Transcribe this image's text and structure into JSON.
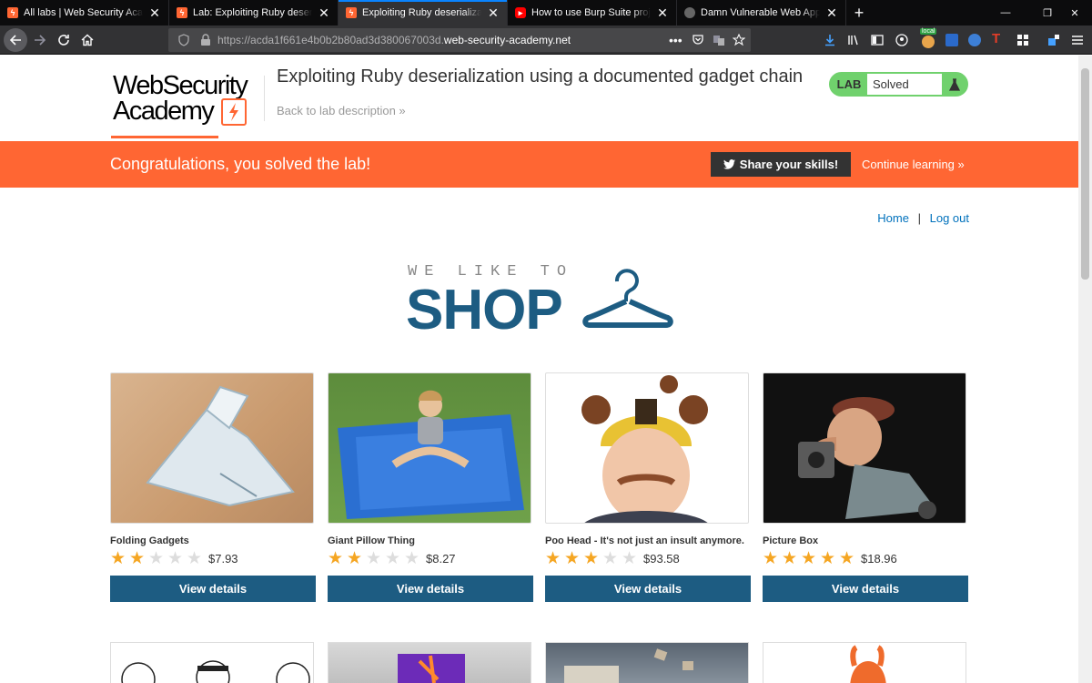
{
  "browser": {
    "tabs": [
      {
        "title": "All labs | Web Security Academy",
        "favicon": "web-security-academy-icon",
        "active": false
      },
      {
        "title": "Lab: Exploiting Ruby deserialization",
        "favicon": "web-security-academy-icon",
        "active": false
      },
      {
        "title": "Exploiting Ruby deserialization",
        "favicon": "web-security-academy-icon",
        "active": true
      },
      {
        "title": "How to use Burp Suite projects",
        "favicon": "youtube-icon",
        "active": false
      },
      {
        "title": "Damn Vulnerable Web App (DVWA)",
        "favicon": "dvwa-icon",
        "active": false
      }
    ],
    "url_prefix": "https://acda1f661e4b0b2b80ad3d380067003d.",
    "url_domain": "web-security-academy.net",
    "extension_badge": "local"
  },
  "header": {
    "logo_line1": "WebSecurity",
    "logo_line2": "Academy",
    "lab_title": "Exploiting Ruby deserialization using a documented gadget chain",
    "back_link": "Back to lab description",
    "lab_label": "LAB",
    "lab_status": "Solved"
  },
  "banner": {
    "message": "Congratulations, you solved the lab!",
    "share_button": "Share your skills!",
    "continue_link": "Continue learning"
  },
  "nav": {
    "home": "Home",
    "separator": "|",
    "logout": "Log out"
  },
  "shop": {
    "tagline": "WE LIKE TO",
    "title": "SHOP"
  },
  "products": [
    {
      "name": "Folding Gadgets",
      "rating": 2,
      "price": "$7.93",
      "button": "View details"
    },
    {
      "name": "Giant Pillow Thing",
      "rating": 2,
      "price": "$8.27",
      "button": "View details"
    },
    {
      "name": "Poo Head - It's not just an insult anymore.",
      "rating": 3,
      "price": "$93.58",
      "button": "View details"
    },
    {
      "name": "Picture Box",
      "rating": 5,
      "price": "$18.96",
      "button": "View details"
    }
  ],
  "colors": {
    "accent": "#ff6633",
    "primary": "#1d5c82",
    "solved_green": "#70d16d",
    "star": "#f5a623"
  }
}
